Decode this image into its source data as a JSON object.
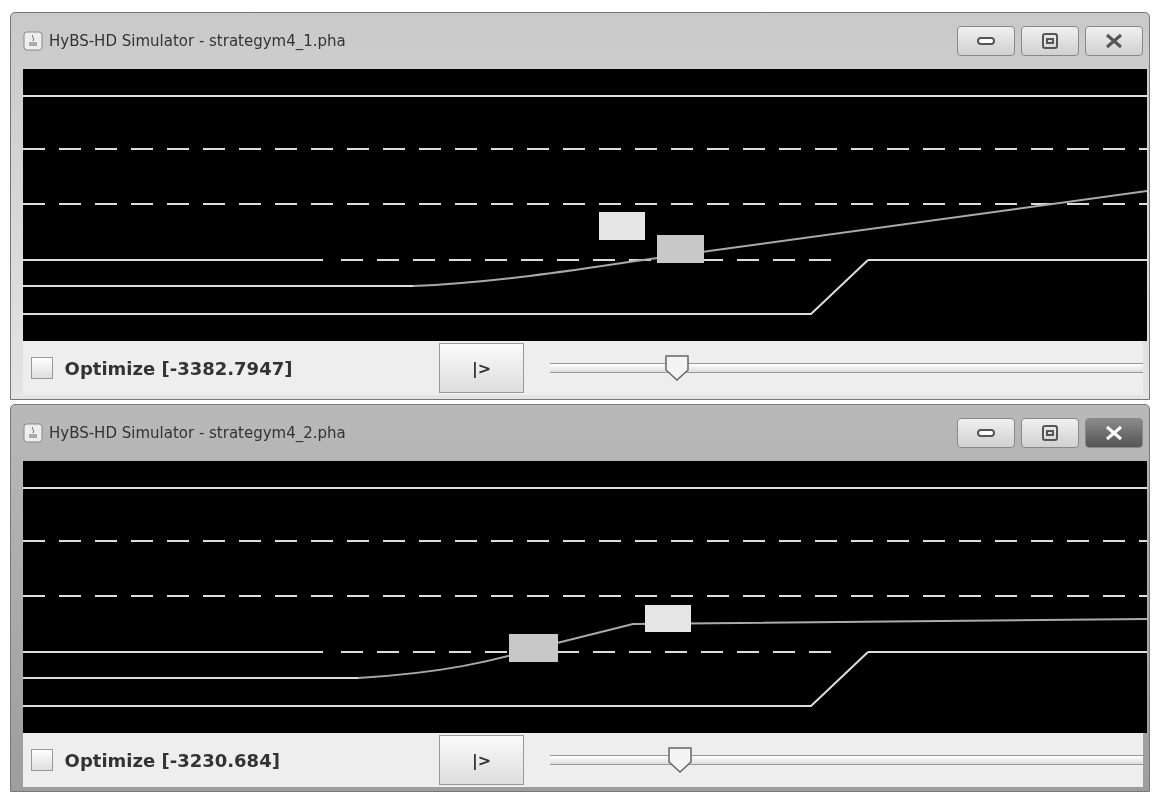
{
  "windows": [
    {
      "title": "HyBS-HD Simulator - strategym4_1.pha",
      "active": false,
      "optimize": {
        "label": "Optimize [-3382.7947]",
        "checked": false
      },
      "play_button": "|>",
      "slider": {
        "level": 0.215
      }
    },
    {
      "title": "HyBS-HD Simulator - strategym4_2.pha",
      "active": true,
      "optimize": {
        "label": "Optimize [-3230.684]",
        "checked": false
      },
      "play_button": "|>",
      "slider": {
        "level": 0.22
      }
    }
  ]
}
